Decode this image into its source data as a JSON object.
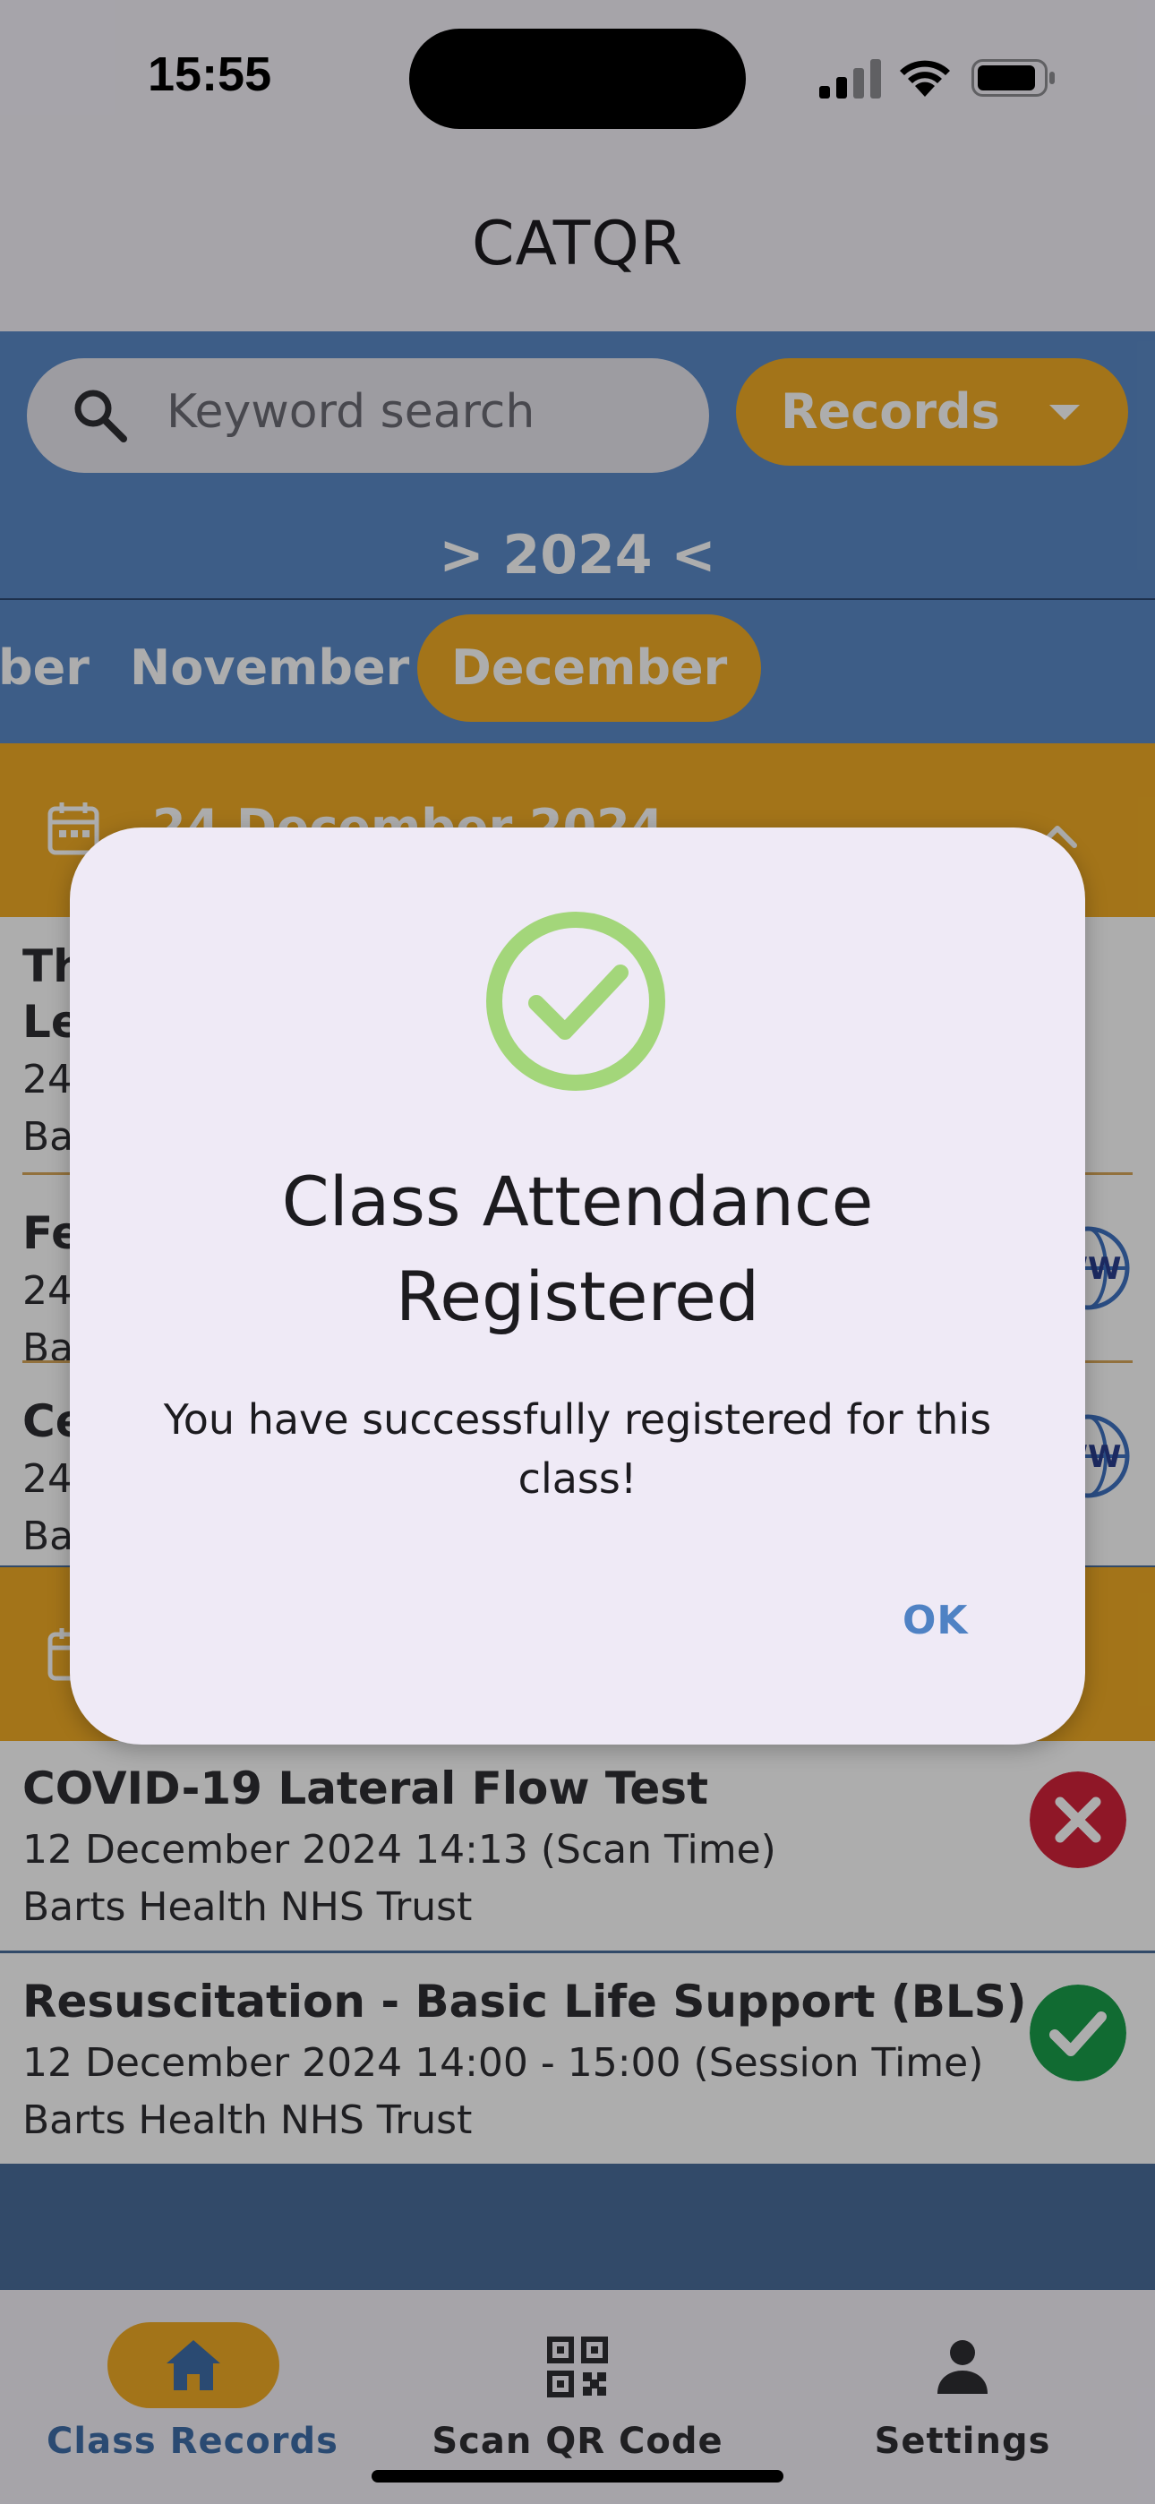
{
  "status_bar": {
    "time": "15:55"
  },
  "app_bar": {
    "title": "CATQR"
  },
  "filters": {
    "search_placeholder": "Keyword search",
    "records_label": "Records"
  },
  "year_nav": {
    "label": "> 2024 <"
  },
  "months": [
    "ber",
    "November",
    "December"
  ],
  "active_month": "December",
  "groups": [
    {
      "title": "24 December 2024",
      "records": [
        {
          "title": "Th",
          "title_line2": "Le",
          "line1": "24",
          "line2": "Ba"
        },
        {
          "title": "Fe",
          "line1": "24",
          "line2": "Ba"
        },
        {
          "title": "Ce",
          "line1": "24",
          "line2": "Ba"
        }
      ]
    },
    {
      "title": "",
      "records": [
        {
          "title": "COVID-19 Lateral Flow Test",
          "line1": "12 December 2024 14:13 (Scan Time)",
          "line2": "Barts Health NHS Trust",
          "status": "failed"
        },
        {
          "title": "Resuscitation - Basic Life Support (BLS)",
          "line1": "12 December 2024 14:00 - 15:00 (Session Time)",
          "line2": "Barts Health NHS Trust",
          "status": "passed"
        }
      ]
    }
  ],
  "bottom_nav": [
    {
      "label": "Class Records",
      "icon": "home-icon",
      "active": true
    },
    {
      "label": "Scan QR Code",
      "icon": "qr-code-icon",
      "active": false
    },
    {
      "label": "Settings",
      "icon": "person-icon",
      "active": false
    }
  ],
  "dialog": {
    "icon": "check-circle-icon",
    "title_line1": "Class Attendance",
    "title_line2": "Registered",
    "body_line1": "You have successfully registered for this",
    "body_line2": "class!",
    "ok_label": "OK"
  },
  "colors": {
    "accent": "#f0ac25",
    "primary_blue": "#5b8ac7",
    "success_green": "#1a9e4a",
    "error_red": "#d3223a",
    "dialog_check": "#a3d67a",
    "ok_text": "#4f82c4"
  }
}
